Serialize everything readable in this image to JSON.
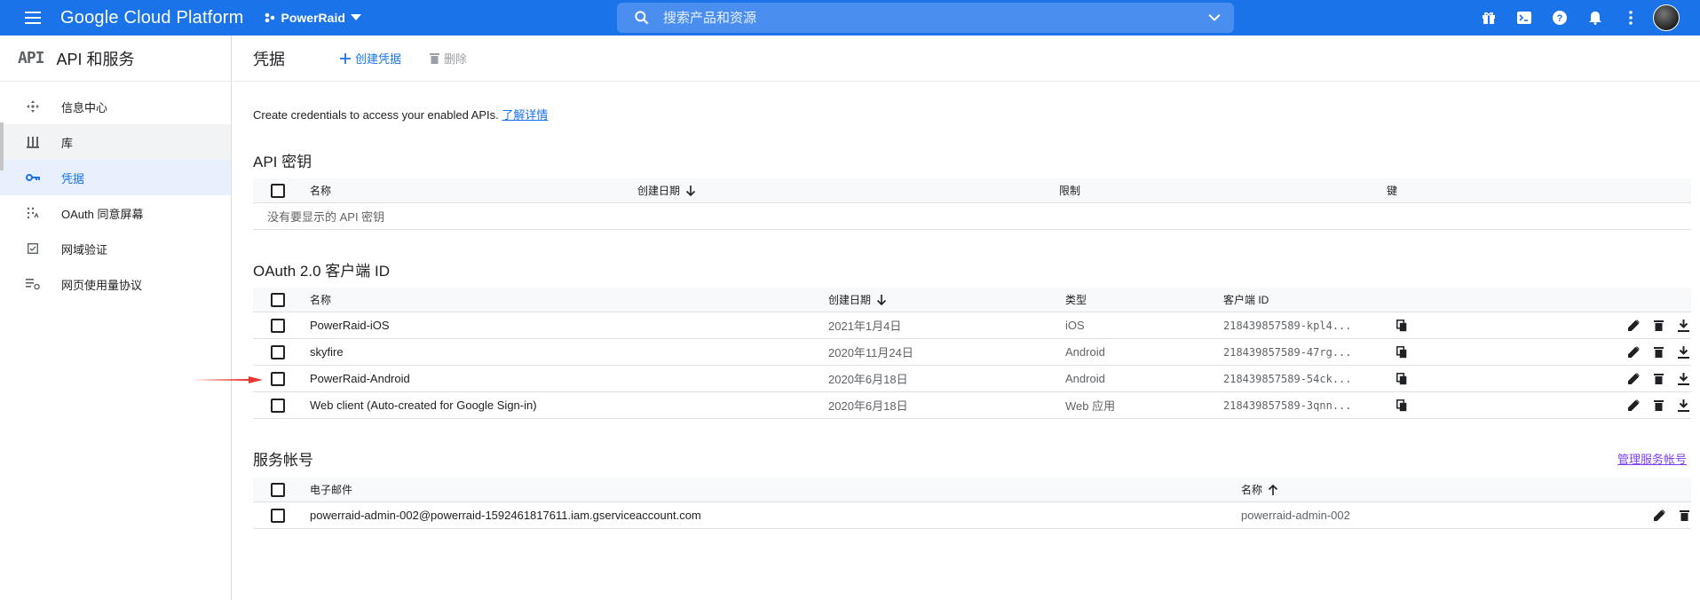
{
  "topbar": {
    "brand": "Google Cloud Platform",
    "project": "PowerRaid",
    "search_placeholder": "搜索产品和资源",
    "icons": [
      "gift-icon",
      "terminal-icon",
      "help-icon",
      "bell-icon",
      "more-vert-icon",
      "avatar"
    ]
  },
  "sidebar": {
    "logo": "API",
    "title": "API 和服务",
    "items": [
      {
        "label": "信息中心",
        "icon": "dashboard-icon"
      },
      {
        "label": "库",
        "icon": "library-icon"
      },
      {
        "label": "凭据",
        "icon": "key-icon",
        "active": true
      },
      {
        "label": "OAuth 同意屏幕",
        "icon": "consent-icon"
      },
      {
        "label": "网域验证",
        "icon": "checkbox-icon"
      },
      {
        "label": "网页使用量协议",
        "icon": "settings-list-icon"
      }
    ]
  },
  "header": {
    "title": "凭据",
    "create_label": "创建凭据",
    "delete_label": "删除"
  },
  "intro": {
    "text": "Create credentials to access your enabled APIs. ",
    "link": "了解详情"
  },
  "api_keys": {
    "title": "API 密钥",
    "columns": {
      "name": "名称",
      "created": "创建日期",
      "restriction": "限制",
      "key": "键"
    },
    "empty_text": "没有要显示的 API 密钥"
  },
  "oauth": {
    "title": "OAuth 2.0 客户端 ID",
    "columns": {
      "name": "名称",
      "created": "创建日期",
      "type": "类型",
      "client_id": "客户端 ID"
    },
    "rows": [
      {
        "name": "PowerRaid-iOS",
        "created": "2021年1月4日",
        "type": "iOS",
        "client_id": "218439857589-kpl4..."
      },
      {
        "name": "skyfire",
        "created": "2020年11月24日",
        "type": "Android",
        "client_id": "218439857589-47rg..."
      },
      {
        "name": "PowerRaid-Android",
        "created": "2020年6月18日",
        "type": "Android",
        "client_id": "218439857589-54ck..."
      },
      {
        "name": "Web client (Auto-created for Google Sign-in)",
        "created": "2020年6月18日",
        "type": "Web 应用",
        "client_id": "218439857589-3qnn..."
      }
    ]
  },
  "service_accounts": {
    "title": "服务帐号",
    "manage_label": "管理服务帐号",
    "columns": {
      "email": "电子邮件",
      "name": "名称"
    },
    "rows": [
      {
        "email": "powerraid-admin-002@powerraid-1592461817611.iam.gserviceaccount.com",
        "name": "powerraid-admin-002"
      }
    ]
  },
  "colors": {
    "accent": "#1a73e8",
    "annotation_arrow": "#e53935"
  }
}
